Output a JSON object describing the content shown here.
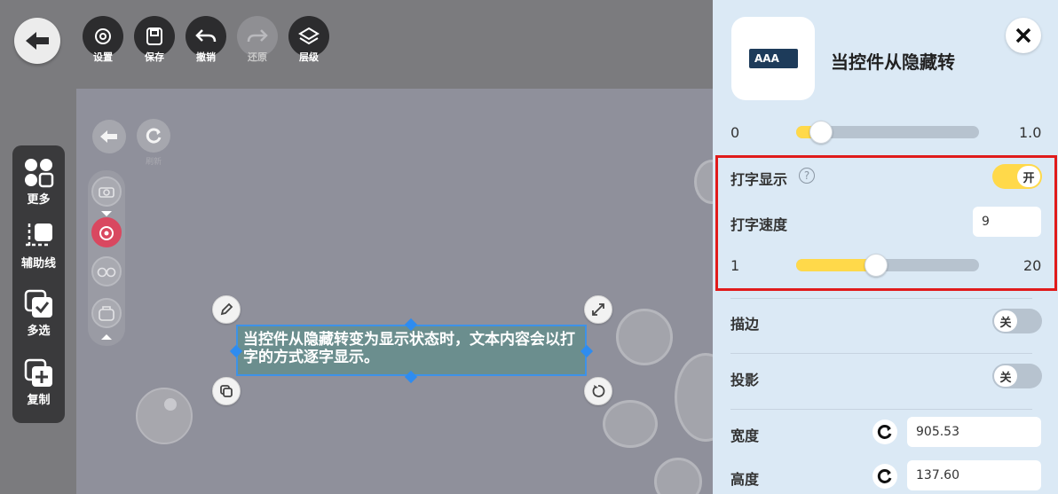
{
  "toolbar": {
    "tools": [
      {
        "label": "设置",
        "icon": "gear-icon"
      },
      {
        "label": "保存",
        "icon": "save-icon"
      },
      {
        "label": "撤销",
        "icon": "undo-icon"
      },
      {
        "label": "还原",
        "icon": "redo-icon"
      },
      {
        "label": "层级",
        "icon": "layers-icon"
      }
    ]
  },
  "sidebar": {
    "items": [
      {
        "label": "更多",
        "icon": "grid-icon"
      },
      {
        "label": "辅助线",
        "icon": "guide-icon"
      },
      {
        "label": "多选",
        "icon": "multi-select-icon"
      },
      {
        "label": "复制",
        "icon": "copy-icon"
      }
    ]
  },
  "canvas": {
    "mini_refresh_label": "刷新",
    "textbox_text": "当控件从隐藏转变为显示状态时，文本内容会以打字的方式逐字显示。"
  },
  "panel": {
    "thumb_text": "AAA",
    "title": "当控件从隐藏转",
    "opacity": {
      "min": "0",
      "max": "1.0",
      "value": 0.05
    },
    "typewriter": {
      "label": "打字显示",
      "help": "?",
      "toggle": "开"
    },
    "speed": {
      "label": "打字速度",
      "value": "9",
      "min": "1",
      "max": "20",
      "slider_value": 9
    },
    "stroke": {
      "label": "描边",
      "toggle": "关"
    },
    "shadow": {
      "label": "投影",
      "toggle": "关"
    },
    "width": {
      "label": "宽度",
      "value": "905.53"
    },
    "height": {
      "label": "高度",
      "value": "137.60"
    }
  },
  "colors": {
    "accent": "#ffd94a",
    "highlight": "#e01b1b",
    "selection": "#2e8cf0"
  }
}
